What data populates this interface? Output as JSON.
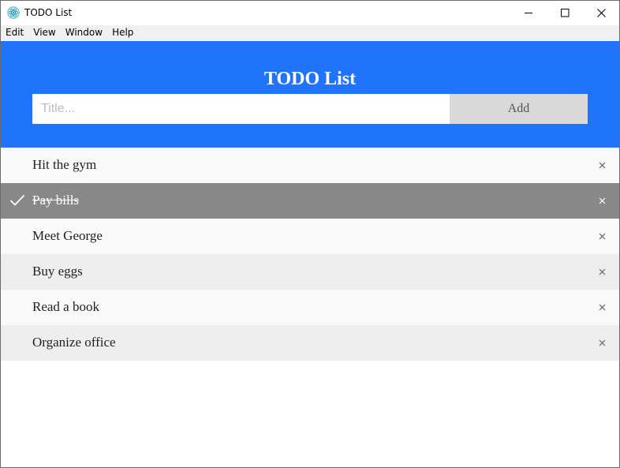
{
  "window": {
    "title": "TODO List",
    "icons": {
      "app": "electron-atom-icon",
      "minimize": "minimize-icon",
      "maximize": "maximize-icon",
      "close": "close-icon"
    }
  },
  "menubar": {
    "items": [
      {
        "label": "Edit"
      },
      {
        "label": "View"
      },
      {
        "label": "Window"
      },
      {
        "label": "Help"
      }
    ]
  },
  "header": {
    "title": "TODO List",
    "input_value": "",
    "input_placeholder": "Title...",
    "add_label": "Add"
  },
  "todos": [
    {
      "label": "Hit the gym",
      "done": false
    },
    {
      "label": "Pay bills",
      "done": true
    },
    {
      "label": "Meet George",
      "done": false
    },
    {
      "label": "Buy eggs",
      "done": false
    },
    {
      "label": "Read a book",
      "done": false
    },
    {
      "label": "Organize office",
      "done": false
    }
  ],
  "colors": {
    "header_bg": "#1f74fb",
    "done_bg": "#888888",
    "row_odd": "#f9f9f9",
    "row_even": "#eeeeee",
    "add_bg": "#d9d9d9"
  }
}
